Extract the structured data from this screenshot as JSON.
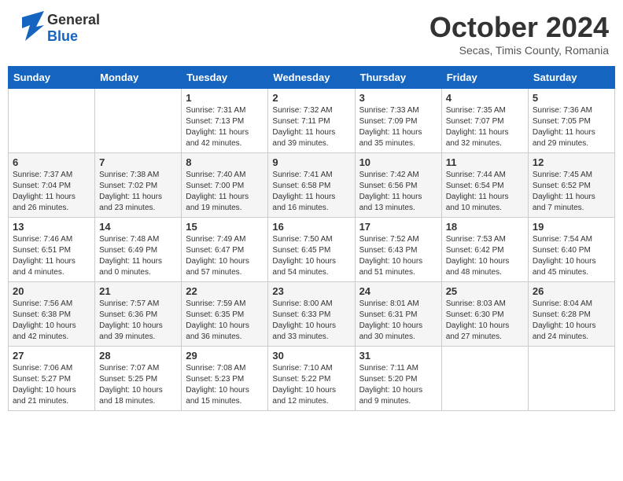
{
  "header": {
    "logo_general": "General",
    "logo_blue": "Blue",
    "month": "October 2024",
    "location": "Secas, Timis County, Romania"
  },
  "days_of_week": [
    "Sunday",
    "Monday",
    "Tuesday",
    "Wednesday",
    "Thursday",
    "Friday",
    "Saturday"
  ],
  "weeks": [
    [
      {
        "day": "",
        "info": ""
      },
      {
        "day": "",
        "info": ""
      },
      {
        "day": "1",
        "sunrise": "Sunrise: 7:31 AM",
        "sunset": "Sunset: 7:13 PM",
        "daylight": "Daylight: 11 hours and 42 minutes."
      },
      {
        "day": "2",
        "sunrise": "Sunrise: 7:32 AM",
        "sunset": "Sunset: 7:11 PM",
        "daylight": "Daylight: 11 hours and 39 minutes."
      },
      {
        "day": "3",
        "sunrise": "Sunrise: 7:33 AM",
        "sunset": "Sunset: 7:09 PM",
        "daylight": "Daylight: 11 hours and 35 minutes."
      },
      {
        "day": "4",
        "sunrise": "Sunrise: 7:35 AM",
        "sunset": "Sunset: 7:07 PM",
        "daylight": "Daylight: 11 hours and 32 minutes."
      },
      {
        "day": "5",
        "sunrise": "Sunrise: 7:36 AM",
        "sunset": "Sunset: 7:05 PM",
        "daylight": "Daylight: 11 hours and 29 minutes."
      }
    ],
    [
      {
        "day": "6",
        "sunrise": "Sunrise: 7:37 AM",
        "sunset": "Sunset: 7:04 PM",
        "daylight": "Daylight: 11 hours and 26 minutes."
      },
      {
        "day": "7",
        "sunrise": "Sunrise: 7:38 AM",
        "sunset": "Sunset: 7:02 PM",
        "daylight": "Daylight: 11 hours and 23 minutes."
      },
      {
        "day": "8",
        "sunrise": "Sunrise: 7:40 AM",
        "sunset": "Sunset: 7:00 PM",
        "daylight": "Daylight: 11 hours and 19 minutes."
      },
      {
        "day": "9",
        "sunrise": "Sunrise: 7:41 AM",
        "sunset": "Sunset: 6:58 PM",
        "daylight": "Daylight: 11 hours and 16 minutes."
      },
      {
        "day": "10",
        "sunrise": "Sunrise: 7:42 AM",
        "sunset": "Sunset: 6:56 PM",
        "daylight": "Daylight: 11 hours and 13 minutes."
      },
      {
        "day": "11",
        "sunrise": "Sunrise: 7:44 AM",
        "sunset": "Sunset: 6:54 PM",
        "daylight": "Daylight: 11 hours and 10 minutes."
      },
      {
        "day": "12",
        "sunrise": "Sunrise: 7:45 AM",
        "sunset": "Sunset: 6:52 PM",
        "daylight": "Daylight: 11 hours and 7 minutes."
      }
    ],
    [
      {
        "day": "13",
        "sunrise": "Sunrise: 7:46 AM",
        "sunset": "Sunset: 6:51 PM",
        "daylight": "Daylight: 11 hours and 4 minutes."
      },
      {
        "day": "14",
        "sunrise": "Sunrise: 7:48 AM",
        "sunset": "Sunset: 6:49 PM",
        "daylight": "Daylight: 11 hours and 0 minutes."
      },
      {
        "day": "15",
        "sunrise": "Sunrise: 7:49 AM",
        "sunset": "Sunset: 6:47 PM",
        "daylight": "Daylight: 10 hours and 57 minutes."
      },
      {
        "day": "16",
        "sunrise": "Sunrise: 7:50 AM",
        "sunset": "Sunset: 6:45 PM",
        "daylight": "Daylight: 10 hours and 54 minutes."
      },
      {
        "day": "17",
        "sunrise": "Sunrise: 7:52 AM",
        "sunset": "Sunset: 6:43 PM",
        "daylight": "Daylight: 10 hours and 51 minutes."
      },
      {
        "day": "18",
        "sunrise": "Sunrise: 7:53 AM",
        "sunset": "Sunset: 6:42 PM",
        "daylight": "Daylight: 10 hours and 48 minutes."
      },
      {
        "day": "19",
        "sunrise": "Sunrise: 7:54 AM",
        "sunset": "Sunset: 6:40 PM",
        "daylight": "Daylight: 10 hours and 45 minutes."
      }
    ],
    [
      {
        "day": "20",
        "sunrise": "Sunrise: 7:56 AM",
        "sunset": "Sunset: 6:38 PM",
        "daylight": "Daylight: 10 hours and 42 minutes."
      },
      {
        "day": "21",
        "sunrise": "Sunrise: 7:57 AM",
        "sunset": "Sunset: 6:36 PM",
        "daylight": "Daylight: 10 hours and 39 minutes."
      },
      {
        "day": "22",
        "sunrise": "Sunrise: 7:59 AM",
        "sunset": "Sunset: 6:35 PM",
        "daylight": "Daylight: 10 hours and 36 minutes."
      },
      {
        "day": "23",
        "sunrise": "Sunrise: 8:00 AM",
        "sunset": "Sunset: 6:33 PM",
        "daylight": "Daylight: 10 hours and 33 minutes."
      },
      {
        "day": "24",
        "sunrise": "Sunrise: 8:01 AM",
        "sunset": "Sunset: 6:31 PM",
        "daylight": "Daylight: 10 hours and 30 minutes."
      },
      {
        "day": "25",
        "sunrise": "Sunrise: 8:03 AM",
        "sunset": "Sunset: 6:30 PM",
        "daylight": "Daylight: 10 hours and 27 minutes."
      },
      {
        "day": "26",
        "sunrise": "Sunrise: 8:04 AM",
        "sunset": "Sunset: 6:28 PM",
        "daylight": "Daylight: 10 hours and 24 minutes."
      }
    ],
    [
      {
        "day": "27",
        "sunrise": "Sunrise: 7:06 AM",
        "sunset": "Sunset: 5:27 PM",
        "daylight": "Daylight: 10 hours and 21 minutes."
      },
      {
        "day": "28",
        "sunrise": "Sunrise: 7:07 AM",
        "sunset": "Sunset: 5:25 PM",
        "daylight": "Daylight: 10 hours and 18 minutes."
      },
      {
        "day": "29",
        "sunrise": "Sunrise: 7:08 AM",
        "sunset": "Sunset: 5:23 PM",
        "daylight": "Daylight: 10 hours and 15 minutes."
      },
      {
        "day": "30",
        "sunrise": "Sunrise: 7:10 AM",
        "sunset": "Sunset: 5:22 PM",
        "daylight": "Daylight: 10 hours and 12 minutes."
      },
      {
        "day": "31",
        "sunrise": "Sunrise: 7:11 AM",
        "sunset": "Sunset: 5:20 PM",
        "daylight": "Daylight: 10 hours and 9 minutes."
      },
      {
        "day": "",
        "info": ""
      },
      {
        "day": "",
        "info": ""
      }
    ]
  ]
}
